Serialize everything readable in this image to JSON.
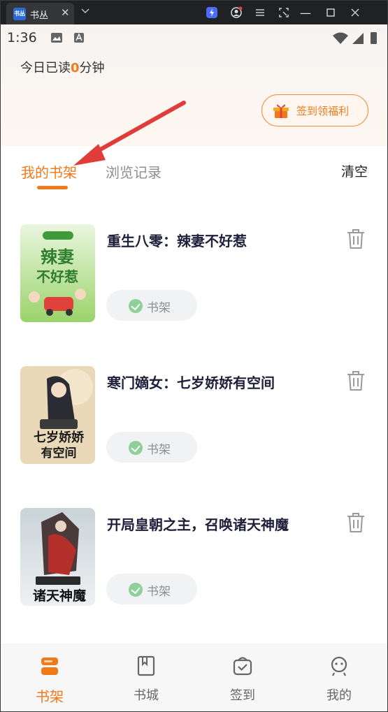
{
  "window": {
    "tab_title": "书丛",
    "tab_icon_text": "书丛",
    "tab_close": "✕",
    "minimize": "—",
    "maximize": "☐",
    "close": "✕"
  },
  "status_bar": {
    "time": "1:36"
  },
  "header": {
    "read_prefix": "今日已读",
    "read_minutes": "0",
    "read_suffix": "分钟",
    "signin_label": "签到领福利"
  },
  "tabs": {
    "mine": "我的书架",
    "history": "浏览记录",
    "clear": "清空"
  },
  "books": [
    {
      "title": "重生八零：辣妻不好惹",
      "shelf_label": "书架",
      "cover_text": "辣妻不好惹"
    },
    {
      "title": "寒门嫡女：七岁娇娇有空间",
      "shelf_label": "书架",
      "cover_text": "七岁娇娇有空间"
    },
    {
      "title": "开局皇朝之主，召唤诸天神魔",
      "shelf_label": "书架",
      "cover_text": "诸天神魔"
    }
  ],
  "bottom_nav": [
    {
      "label": "书架",
      "icon": "bookshelf-icon",
      "active": true
    },
    {
      "label": "书城",
      "icon": "book-icon",
      "active": false
    },
    {
      "label": "签到",
      "icon": "checkin-icon",
      "active": false
    },
    {
      "label": "我的",
      "icon": "profile-icon",
      "active": false
    }
  ],
  "colors": {
    "accent": "#f07a1a",
    "title_text": "#1f1f3a",
    "muted_text": "#8e8e93",
    "annotation_arrow": "#e03c3c"
  }
}
